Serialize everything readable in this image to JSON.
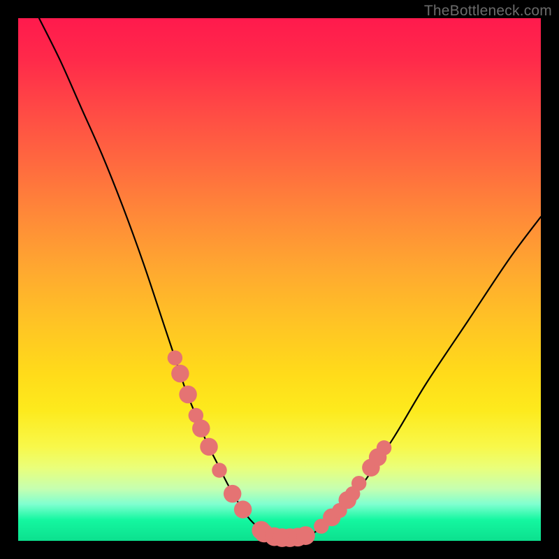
{
  "watermark": "TheBottleneck.com",
  "colors": {
    "frame": "#000000",
    "curve": "#000000",
    "marker_fill": "#e57373",
    "marker_stroke": "#c95d5d"
  },
  "chart_data": {
    "type": "line",
    "title": "",
    "xlabel": "",
    "ylabel": "",
    "xlim": [
      0,
      100
    ],
    "ylim": [
      0,
      100
    ],
    "grid": false,
    "legend": false,
    "series": [
      {
        "name": "curve",
        "x": [
          4,
          8,
          12,
          16,
          20,
          24,
          28,
          30,
          32,
          34,
          36,
          38,
          40,
          42,
          44,
          46,
          48,
          50,
          52,
          55,
          58,
          62,
          66,
          72,
          78,
          86,
          94,
          100
        ],
        "y": [
          100,
          92,
          83,
          74,
          64,
          53,
          41,
          35,
          29,
          24,
          19,
          15,
          11,
          7.5,
          4.5,
          2.5,
          1.2,
          0.5,
          0.5,
          0.8,
          2.5,
          6,
          11,
          20,
          30,
          42,
          54,
          62
        ]
      }
    ],
    "markers": [
      {
        "x": 30.0,
        "y": 35.0,
        "r": 1.0
      },
      {
        "x": 31.0,
        "y": 32.0,
        "r": 1.3
      },
      {
        "x": 32.5,
        "y": 28.0,
        "r": 1.3
      },
      {
        "x": 34.0,
        "y": 24.0,
        "r": 1.0
      },
      {
        "x": 35.0,
        "y": 21.5,
        "r": 1.3
      },
      {
        "x": 36.5,
        "y": 18.0,
        "r": 1.3
      },
      {
        "x": 38.5,
        "y": 13.5,
        "r": 1.0
      },
      {
        "x": 41.0,
        "y": 9.0,
        "r": 1.3
      },
      {
        "x": 43.0,
        "y": 6.0,
        "r": 1.3
      },
      {
        "x": 46.5,
        "y": 2.0,
        "r": 1.4
      },
      {
        "x": 47.0,
        "y": 1.5,
        "r": 1.4
      },
      {
        "x": 49.0,
        "y": 0.8,
        "r": 1.4
      },
      {
        "x": 50.5,
        "y": 0.6,
        "r": 1.4
      },
      {
        "x": 52.0,
        "y": 0.6,
        "r": 1.4
      },
      {
        "x": 53.5,
        "y": 0.7,
        "r": 1.4
      },
      {
        "x": 55.0,
        "y": 1.0,
        "r": 1.4
      },
      {
        "x": 58.0,
        "y": 2.8,
        "r": 1.0
      },
      {
        "x": 60.0,
        "y": 4.5,
        "r": 1.3
      },
      {
        "x": 61.5,
        "y": 5.8,
        "r": 1.0
      },
      {
        "x": 63.0,
        "y": 7.8,
        "r": 1.3
      },
      {
        "x": 64.0,
        "y": 9.0,
        "r": 1.0
      },
      {
        "x": 65.2,
        "y": 11.0,
        "r": 1.0
      },
      {
        "x": 67.5,
        "y": 14.0,
        "r": 1.3
      },
      {
        "x": 68.8,
        "y": 16.0,
        "r": 1.3
      },
      {
        "x": 70.0,
        "y": 17.8,
        "r": 1.0
      }
    ]
  }
}
